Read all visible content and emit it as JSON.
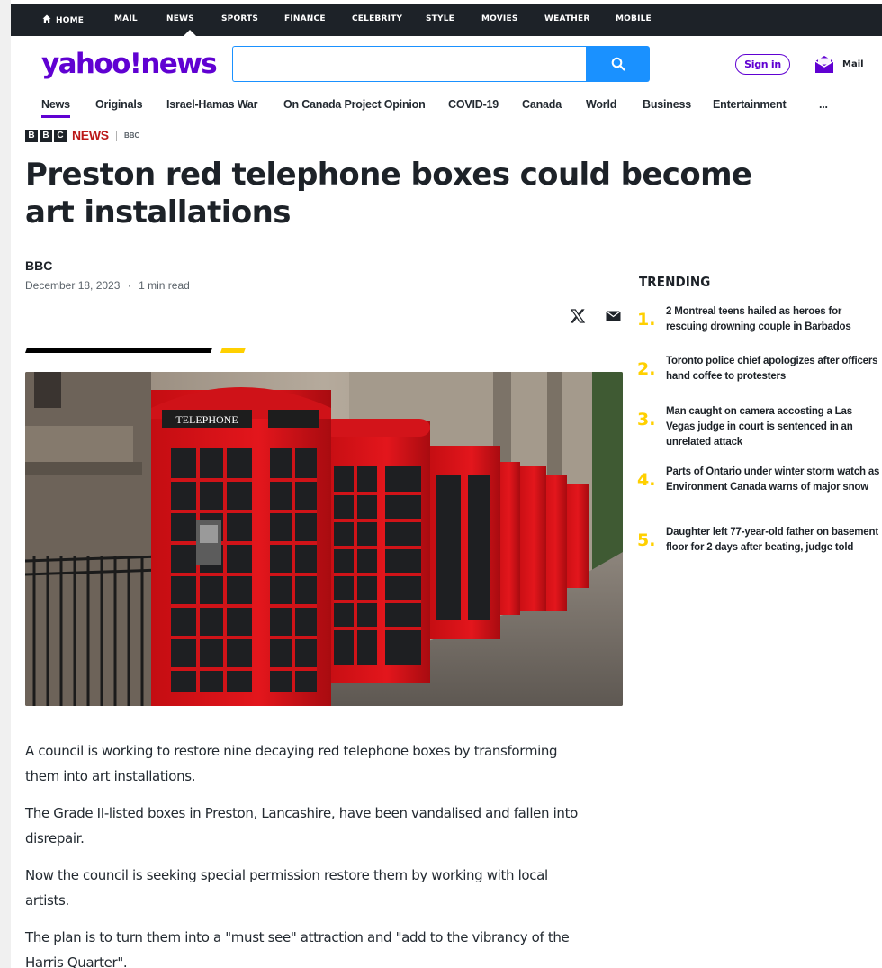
{
  "topnav": {
    "items": [
      "HOME",
      "MAIL",
      "NEWS",
      "SPORTS",
      "FINANCE",
      "CELEBRITY",
      "STYLE",
      "MOVIES",
      "WEATHER",
      "MOBILE"
    ]
  },
  "header": {
    "logo": "yahoo!news",
    "search_placeholder": "",
    "signin_label": "Sign in",
    "mail_label": "Mail"
  },
  "subnav": {
    "items": [
      "News",
      "Originals",
      "Israel-Hamas War",
      "On Canada Project Opinion",
      "COVID-19",
      "Canada",
      "World",
      "Business",
      "Entertainment",
      "..."
    ],
    "active": "News"
  },
  "source": {
    "blocks": [
      "B",
      "B",
      "C"
    ],
    "brand": "NEWS",
    "provider": "BBC"
  },
  "article": {
    "headline": "Preston red telephone boxes could become art installations",
    "author": "BBC",
    "date": "December 18, 2023",
    "separator": "·",
    "read_time": "1 min read",
    "paragraphs": [
      "A council is working to restore nine decaying red telephone boxes by transforming them into art installations.",
      "The Grade II-listed boxes in Preston, Lancashire, have been vandalised and fallen into disrepair.",
      "Now the council is seeking special permission restore them by working with local artists.",
      "The plan is to turn them into a \"must see\" attraction and \"add to the vibrancy of the Harris Quarter\"."
    ],
    "image_sign": "TELEPHONE"
  },
  "trending": {
    "title": "TRENDING",
    "items": [
      {
        "rank": "1.",
        "text": "2 Montreal teens hailed as heroes for rescuing drowning couple in Barbados"
      },
      {
        "rank": "2.",
        "text": "Toronto police chief apologizes after officers hand coffee to protesters"
      },
      {
        "rank": "3.",
        "text": "Man caught on camera accosting a Las Vegas judge in court is sentenced in an unrelated attack"
      },
      {
        "rank": "4.",
        "text": "Parts of Ontario under winter storm watch as Environment Canada warns of major snow"
      },
      {
        "rank": "5.",
        "text": "Daughter left 77-year-old father on basement floor for 2 days after beating, judge told"
      }
    ]
  },
  "colors": {
    "brand_purple": "#6001d2",
    "search_blue": "#1a91ff",
    "trending_yellow": "#ffd000",
    "bbc_red": "#bb1919",
    "topbar_bg": "#1d2228"
  }
}
